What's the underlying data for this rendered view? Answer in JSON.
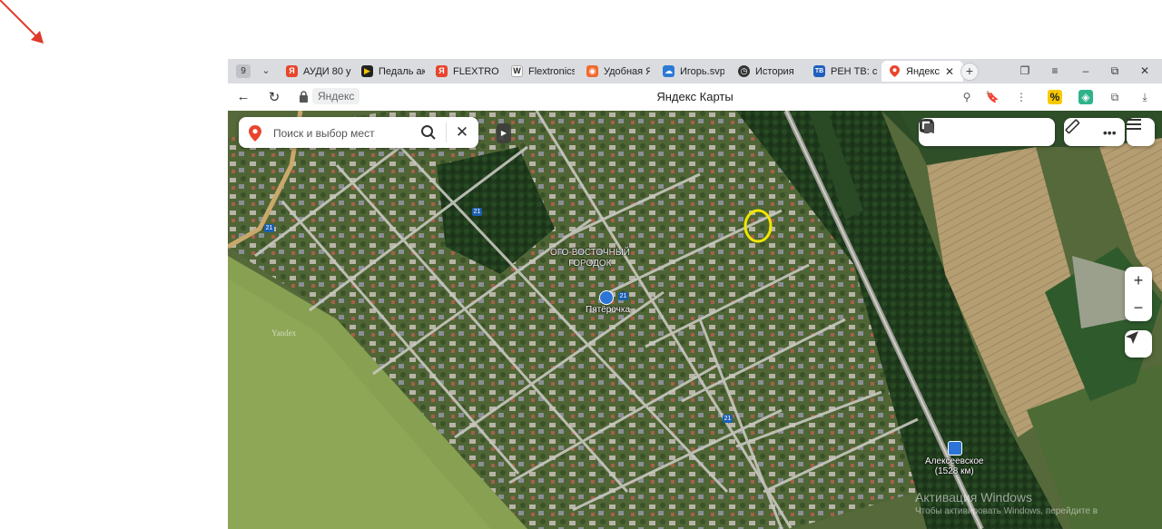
{
  "browser": {
    "tab_count": "9",
    "tabs": [
      {
        "label": "АУДИ 80 у",
        "icon": "yandex-icon",
        "color": "#e8452c"
      },
      {
        "label": "Педаль ак",
        "icon": "play-icon",
        "color": "#f6c400"
      },
      {
        "label": "FLEXTRON",
        "icon": "yandex-icon",
        "color": "#e8452c"
      },
      {
        "label": "Flextronics",
        "icon": "wikipedia-icon",
        "color": "#ffffff"
      },
      {
        "label": "Удобная Я",
        "icon": "podcast-icon",
        "color": "#f26a2e"
      },
      {
        "label": "Игорь.svp",
        "icon": "cloud-icon",
        "color": "#2e7bd6"
      },
      {
        "label": "История",
        "icon": "clock-icon",
        "color": "#333333"
      },
      {
        "label": "РЕН ТВ: см",
        "icon": "tv-icon",
        "color": "#1f5fbf"
      },
      {
        "label": "Яндекс",
        "icon": "map-pin-icon",
        "color": "#e8452c",
        "active": true
      }
    ],
    "address_chip": "Яндекс",
    "page_title": "Яндекс Карты"
  },
  "map": {
    "search": {
      "placeholder": "Поиск и выбор мест"
    },
    "labels": {
      "town": "ОГО-ВОСТОЧНЫЙ\nГОРОДОК",
      "store": "Пятёрочка",
      "station": "Алексеевское\n(1528 км)",
      "road_number": "21",
      "provider": "Yandex"
    },
    "watermark": {
      "line1": "Активация Windows",
      "line2": "Чтобы активировать Windows, перейдите в"
    },
    "zoom": {
      "in": "+",
      "out": "−"
    }
  }
}
